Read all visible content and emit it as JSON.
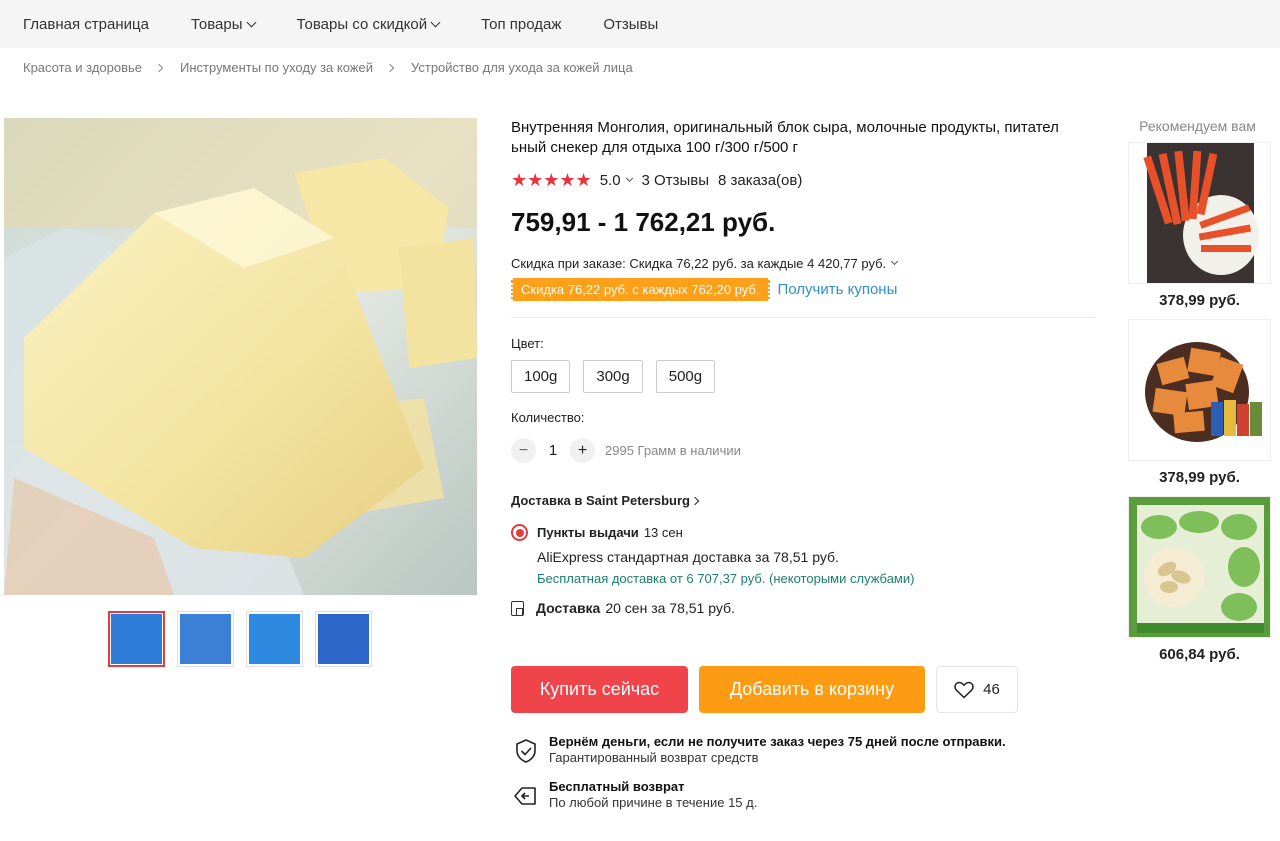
{
  "nav": {
    "items": [
      {
        "label": "Главная страница",
        "has_dropdown": false
      },
      {
        "label": "Товары",
        "has_dropdown": true
      },
      {
        "label": "Товары со скидкой",
        "has_dropdown": true
      },
      {
        "label": "Топ продаж",
        "has_dropdown": false
      },
      {
        "label": "Отзывы",
        "has_dropdown": false
      }
    ]
  },
  "breadcrumb": [
    "Красота и здоровье",
    "Инструменты по уходу за кожей",
    "Устройство для ухода за кожей лица"
  ],
  "product": {
    "title": "Внутренняя Монголия, оригинальный блок сыра, молочные продукты, питательный снекер для отдыха 100 г/300 г/500 г",
    "title_line1": "Внутренняя Монголия, оригинальный блок сыра, молочные продукты, питател",
    "title_line2": "ьный снекер для отдыха 100 г/300 г/500 г",
    "stars": "★★★★★",
    "rating": "5.0",
    "reviews": "3 Отзывы",
    "orders": "8 заказа(ов)",
    "price": "759,91 - 1 762,21 руб.",
    "discount_label": "Скидка при заказе: Скидка 76,22 руб. за каждые 4 420,77 руб.",
    "coupon_tag": "Скидка 76,22 руб. с каждых 762,20 руб.",
    "coupon_link": "Получить купоны",
    "color_label": "Цвет:",
    "options": [
      "100g",
      "300g",
      "500g"
    ],
    "qty_label": "Количество:",
    "qty_value": "1",
    "qty_minus": "−",
    "qty_plus": "+",
    "stock": "2995 Грамм в наличии"
  },
  "delivery": {
    "heading": "Доставка в Saint Petersburg",
    "pickup_title": "Пункты выдачи",
    "pickup_date": "13 сен",
    "standard": "AliExpress стандартная доставка за 78,51 руб.",
    "free": "Бесплатная доставка от 6 707,37 руб. (некоторыми службами)",
    "courier_title": "Доставка",
    "courier_detail": "20 сен за 78,51 руб."
  },
  "actions": {
    "buy": "Купить сейчас",
    "cart": "Добавить в корзину",
    "wishlist_count": "46"
  },
  "guarantees": [
    {
      "title": "Вернём деньги, если не получите заказ через 75 дней после отправки.",
      "text": "Гарантированный возврат средств",
      "icon": "shield-check-icon"
    },
    {
      "title": "Бесплатный возврат",
      "text": "По любой причине в течение 15 д.",
      "icon": "return-icon"
    }
  ],
  "recommend": {
    "title": "Рекомендуем вам",
    "items": [
      {
        "price": "378,99 руб."
      },
      {
        "price": "378,99 руб."
      },
      {
        "price": "606,84 руб."
      }
    ]
  },
  "colors": {
    "accent_red": "#f0444b",
    "accent_orange": "#fd9b12",
    "link_blue": "#2f8fcf",
    "free_green": "#1a7f6e"
  }
}
